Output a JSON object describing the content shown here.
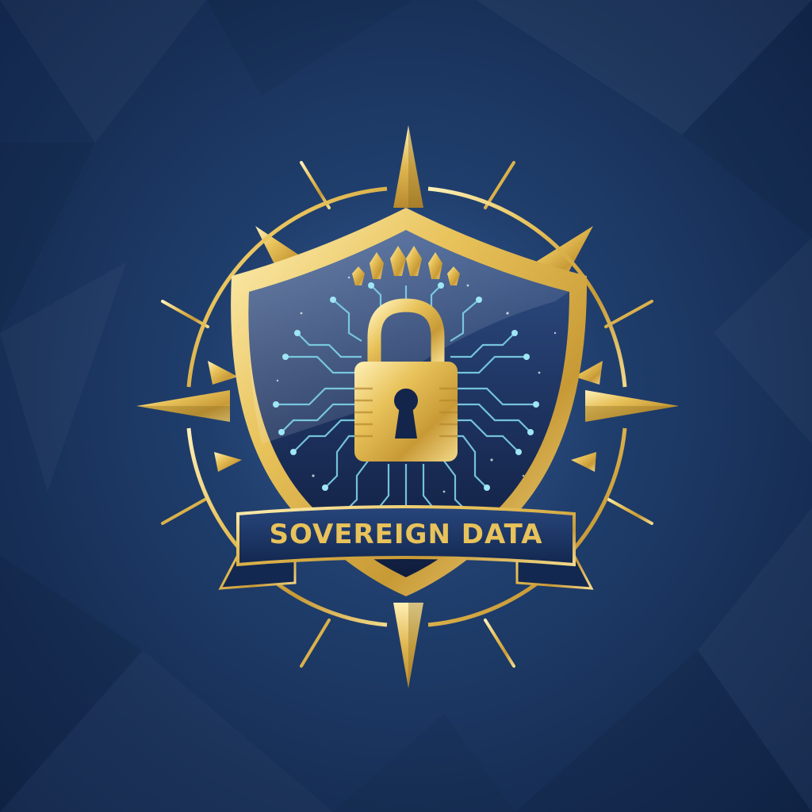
{
  "logo": {
    "banner_text": "SOVEREIGN DATA",
    "icons": [
      "compass-star-icon",
      "shield-icon",
      "crown-icon",
      "padlock-icon",
      "keyhole-icon",
      "circuit-traces-icon"
    ],
    "colors": {
      "background": "#1d3560",
      "gold": "#e8c25a",
      "gold_dark": "#a8842c",
      "navy": "#1b2f5a",
      "circuit": "#7fd3e8"
    }
  }
}
